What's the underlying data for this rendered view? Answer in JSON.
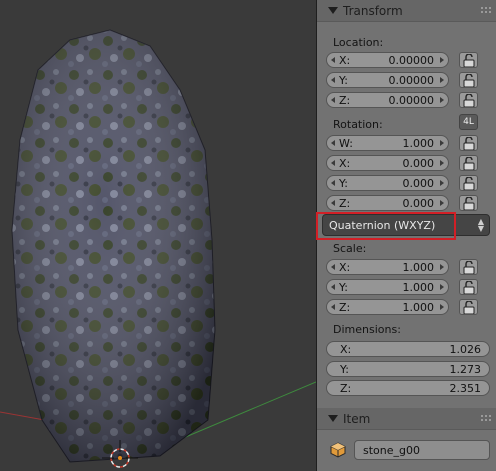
{
  "transform": {
    "title": "Transform",
    "location": {
      "label": "Location:",
      "fields": [
        {
          "axis": "X:",
          "value": "0.00000"
        },
        {
          "axis": "Y:",
          "value": "0.00000"
        },
        {
          "axis": "Z:",
          "value": "0.00000"
        }
      ]
    },
    "rotation": {
      "label": "Rotation:",
      "lock_4l": "4L",
      "fields": [
        {
          "axis": "W:",
          "value": "1.000"
        },
        {
          "axis": "X:",
          "value": "0.000"
        },
        {
          "axis": "Y:",
          "value": "0.000"
        },
        {
          "axis": "Z:",
          "value": "0.000"
        }
      ]
    },
    "rotation_mode": "Quaternion (WXYZ)",
    "scale": {
      "label": "Scale:",
      "fields": [
        {
          "axis": "X:",
          "value": "1.000"
        },
        {
          "axis": "Y:",
          "value": "1.000"
        },
        {
          "axis": "Z:",
          "value": "1.000"
        }
      ]
    },
    "dimensions": {
      "label": "Dimensions:",
      "fields": [
        {
          "axis": "X:",
          "value": "1.026"
        },
        {
          "axis": "Y:",
          "value": "1.273"
        },
        {
          "axis": "Z:",
          "value": "2.351"
        }
      ]
    }
  },
  "item": {
    "title": "Item",
    "object_name": "stone_g00",
    "icon": "cube-icon"
  },
  "colors": {
    "panel_bg": "#727272",
    "field_bg": "#959595",
    "dropdown_bg": "#454545",
    "highlight": "#d21f26"
  }
}
